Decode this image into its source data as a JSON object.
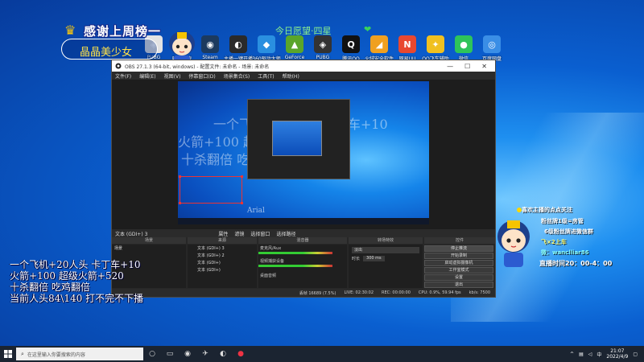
{
  "desktop": {
    "icons": [
      {
        "label": "PUBG",
        "color": "#e3e3e3",
        "glyph": "◈"
      },
      {
        "label": "吃鸡加速",
        "color": "#2f7fd8",
        "glyph": "⟳"
      },
      {
        "label": "Steam",
        "color": "#1c3a5e",
        "glyph": "◉"
      },
      {
        "label": "主播一键开播",
        "color": "#2a2a2a",
        "glyph": "◐"
      },
      {
        "label": "360驱动大师",
        "color": "#2a8fe0",
        "glyph": "◆"
      },
      {
        "label": "GeForce",
        "color": "#5aa52a",
        "glyph": "▲"
      },
      {
        "label": "PUBG",
        "color": "#333333",
        "glyph": "◈"
      },
      {
        "label": "腾讯QQ",
        "color": "#111111",
        "glyph": "Q"
      },
      {
        "label": "火绒安全软件",
        "color": "#f0a020",
        "glyph": "◢"
      },
      {
        "label": "网易UU",
        "color": "#e84830",
        "glyph": "N"
      },
      {
        "label": "QQ飞车辅助",
        "color": "#f0c020",
        "glyph": "✦"
      },
      {
        "label": "微信",
        "color": "#2ec45a",
        "glyph": "●"
      },
      {
        "label": "百度网盘",
        "color": "#3a8ee6",
        "glyph": "◎"
      }
    ]
  },
  "overlay": {
    "thanks_title": "感谢上周榜一",
    "name": "晶晶美少女",
    "goal_text": "今日愿望·四星",
    "gifts": [
      "一个飞机+20人头 卡丁车+10",
      "火箭+100 超级火箭+520",
      "十杀翻倍 吃鸡翻倍",
      "当前人头84\\140 打不完不下播"
    ],
    "right_panel": {
      "title": "喜欢主播的点点关注",
      "fans": "粉丝牌1级=房管",
      "group": "6级粉丝牌进微信群",
      "car": "飞×2上车",
      "wechat_prefix": "微：",
      "wechat_id": "wanclliar86",
      "live_time": "直播时间20：00-4：00"
    }
  },
  "obs": {
    "title": "OBS 27.1.3 (64-bit, windows) - 配置文件: 未命名 - 场景: 未命名",
    "menu": [
      "文件(F)",
      "编辑(E)",
      "视图(V)",
      "停靠窗口(D)",
      "场景集合(S)",
      "工具(T)",
      "帮助(H)"
    ],
    "docks": {
      "scenes": "场景",
      "sources": "来源",
      "mixer": "混音器",
      "transitions": "转场特效",
      "controls": "控件"
    },
    "scene_item": "场景",
    "sources": [
      "文本 (GDI+) 3",
      "文本 (GDI+) 2",
      "文本 (GDI+)",
      "文本 (GDI+)"
    ],
    "mixer_tracks": [
      "麦克风/Aux",
      "视频捕获设备",
      "桌面音频"
    ],
    "transition": {
      "type": "淡出",
      "duration_label": "时长",
      "duration_value": "300 ms"
    },
    "controls": [
      "停止推流",
      "开始录制",
      "启动虚拟摄像机",
      "工作室模式",
      "设置",
      "退出"
    ],
    "toolbar": {
      "properties": "属性",
      "filters": "滤镜",
      "select_window": "选择窗口",
      "select_process": "选择路径"
    },
    "current_source": "文本 (GDI+) 3",
    "preview_label": "Arial",
    "status": {
      "dropped": "丢帧 16689 (7.5%)",
      "live": "LIVE: 02:30:02",
      "rec": "REC: 00:00:00",
      "cpu": "CPU: 0.9%, 59.94 fps",
      "kbps": "kb/s: 7500"
    }
  },
  "taskbar": {
    "search_placeholder": "在这里输入你要搜索的内容",
    "time": "21:07",
    "date": "2022/4/9",
    "ime": "中"
  }
}
